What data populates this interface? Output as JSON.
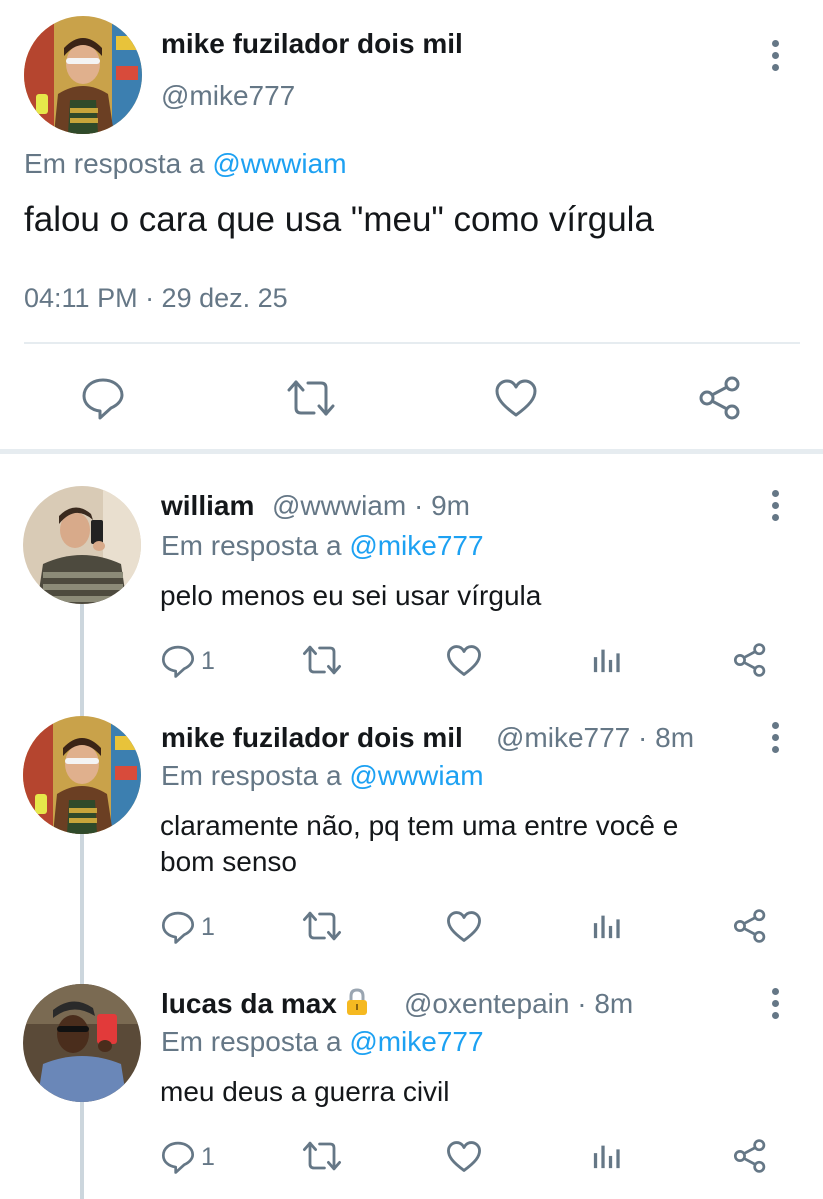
{
  "main_tweet": {
    "name": "mike fuzilador dois mil",
    "handle": "@mike777",
    "reply_prefix": "Em resposta a",
    "reply_mention": "@wwwiam",
    "text": "falou o cara que usa \"meu\" como vírgula",
    "timestamp": "04:11 PM · 29 dez. 25",
    "actions": [
      "reply-icon",
      "retweet-icon",
      "like-icon",
      "share-icon"
    ]
  },
  "replies": [
    {
      "name": "william",
      "handle_time": "@wwwiam · 9m",
      "reply_prefix": "Em resposta a",
      "reply_mention": "@mike777",
      "text": "pelo menos eu sei usar vírgula",
      "reply_count": "1",
      "locked": false
    },
    {
      "name": "mike fuzilador dois mil",
      "handle_time": "@mike777 · 8m",
      "reply_prefix": "Em resposta a",
      "reply_mention": "@wwwiam",
      "text_line1": "claramente não, pq tem uma entre você e",
      "text_line2": "bom senso",
      "reply_count": "1",
      "locked": false
    },
    {
      "name": "lucas da max",
      "handle_time": "@oxentepain · 8m",
      "reply_prefix": "Em resposta a",
      "reply_mention": "@mike777",
      "text": "meu deus a guerra civil",
      "reply_count": "1",
      "locked": true,
      "lock_icon": "lock-icon"
    }
  ],
  "colors": {
    "accent": "#1da1f2",
    "secondary_text": "#657786",
    "primary_text": "#14171a",
    "divider": "#e6ecf0",
    "thread_line": "#ccd6dd"
  }
}
